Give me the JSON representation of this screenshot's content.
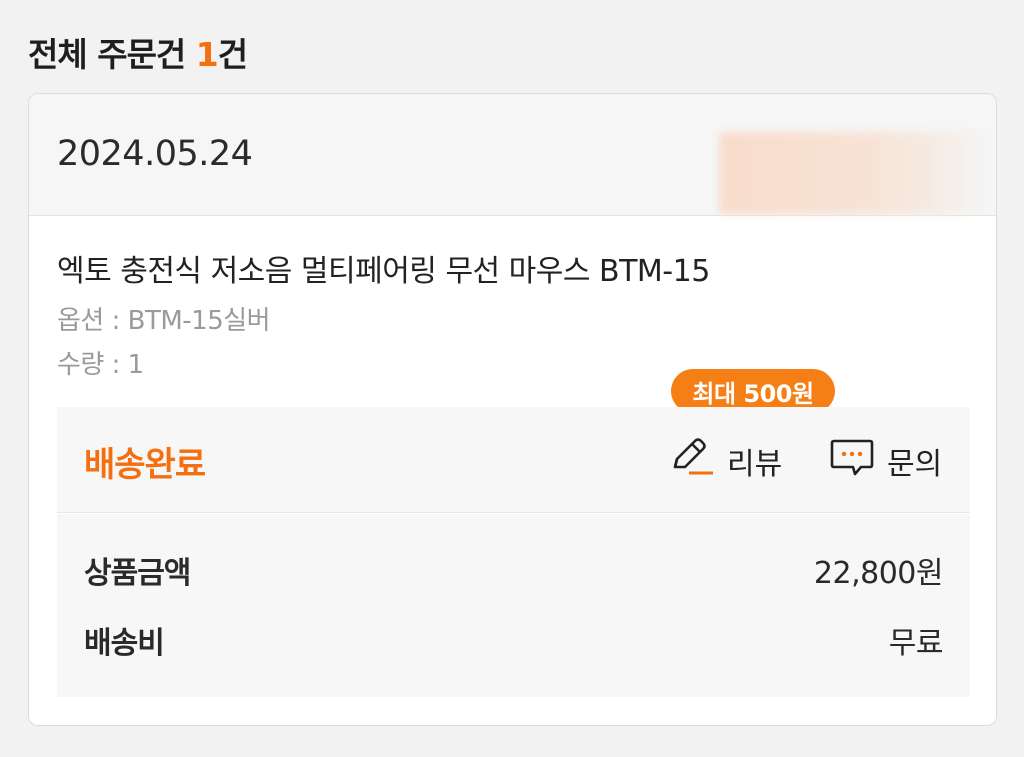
{
  "summary": {
    "prefix": "전체 주문건 ",
    "count": "1",
    "suffix": "건"
  },
  "order": {
    "date": "2024.05.24",
    "product_name": "엑토 충전식 저소음 멀티페어링 무선 마우스 BTM-15",
    "option": "옵션 : BTM-15실버",
    "quantity": "수량 : 1",
    "status": "배송완료",
    "review_badge": "최대 500원",
    "actions": {
      "review_label": "리뷰",
      "review_icon": "pencil-icon",
      "inquiry_label": "문의",
      "inquiry_icon": "chat-bubble-icon"
    },
    "price": {
      "product_amount_label": "상품금액",
      "product_amount_value": "22,800원",
      "shipping_label": "배송비",
      "shipping_value": "무료"
    }
  },
  "colors": {
    "accent": "#f36f0f",
    "tooltip": "#f57f14",
    "background": "#f2f2f2",
    "card": "#ffffff"
  }
}
